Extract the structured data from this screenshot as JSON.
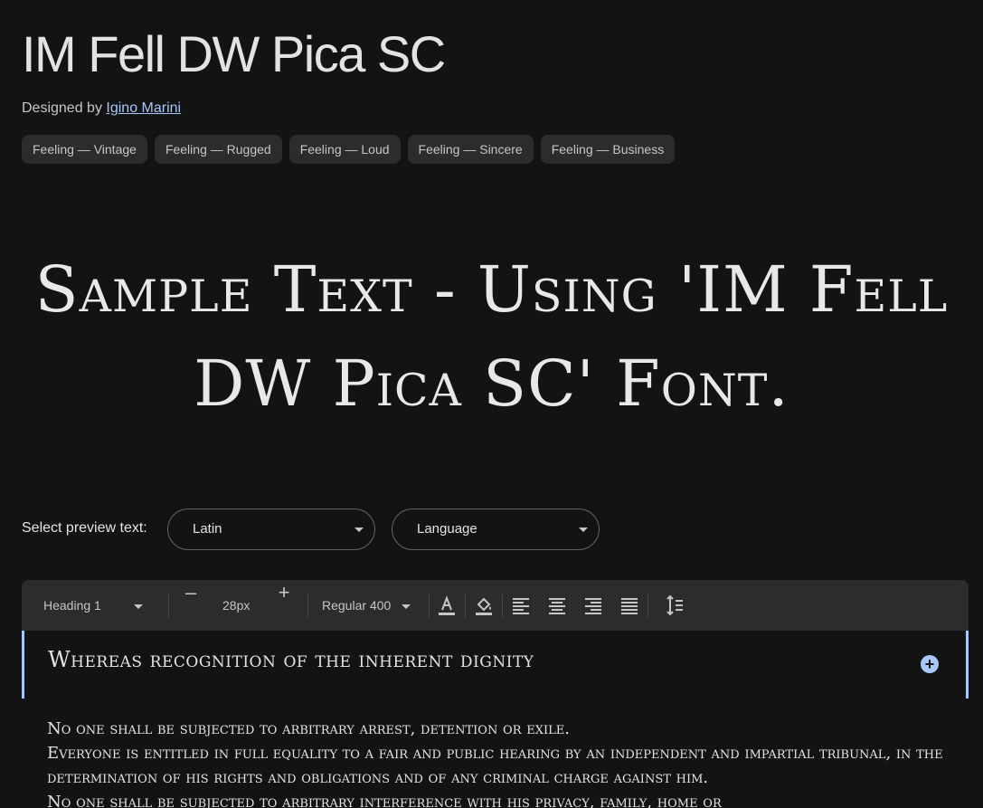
{
  "font": {
    "name": "IM Fell DW Pica SC",
    "designed_by_label": "Designed by",
    "designer": "Igino Marini"
  },
  "tags": [
    "Feeling — Vintage",
    "Feeling — Rugged",
    "Feeling — Loud",
    "Feeling — Sincere",
    "Feeling — Business"
  ],
  "sample_text": "Sample Text - Using 'IM Fell DW Pica SC' Font.",
  "preview": {
    "label": "Select preview text:",
    "script_value": "Latin",
    "language_value": "Language"
  },
  "toolbar": {
    "style": "Heading 1",
    "minus": "–",
    "size": "28px",
    "plus": "+",
    "weight": "Regular 400"
  },
  "editor": {
    "heading": "Whereas recognition of the inherent dignity",
    "paragraphs": [
      "No one shall be subjected to arbitrary arrest, detention or exile.",
      "Everyone is entitled in full equality to a fair and public hearing by an independent and impartial tribunal, in the determination of his rights and obligations and of any criminal charge against him.",
      "No one shall be subjected to arbitrary interference with his privacy, family, home or"
    ]
  },
  "colors": {
    "background": "#131314",
    "accent": "#a8c7fa",
    "chip": "#2b2c2e"
  }
}
